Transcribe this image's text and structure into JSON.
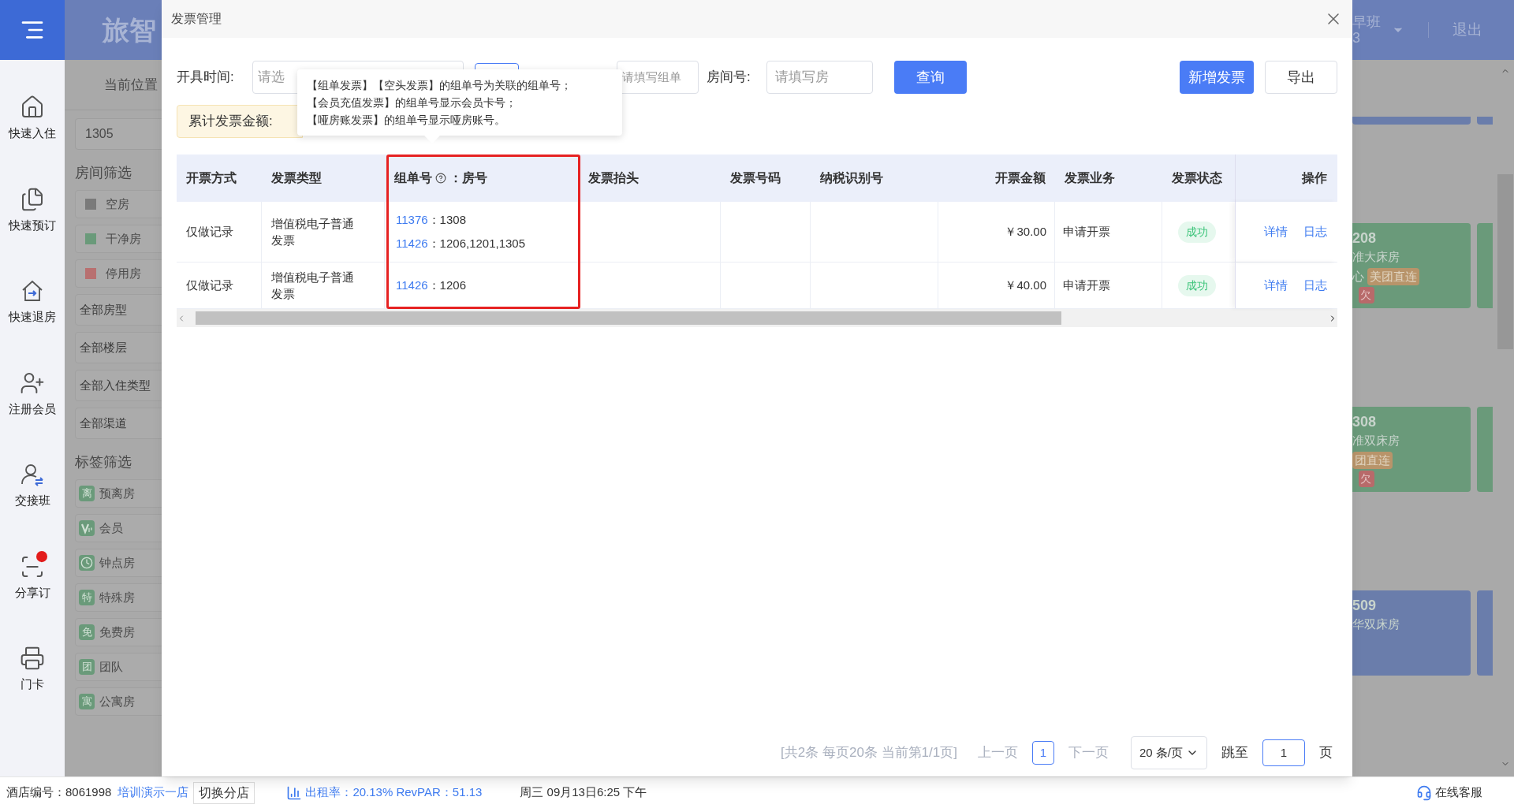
{
  "sidebar": {
    "items": [
      {
        "label": "快速入住",
        "badge": false
      },
      {
        "label": "快速预订",
        "badge": false
      },
      {
        "label": "快速退房",
        "badge": false
      },
      {
        "label": "注册会员",
        "badge": false
      },
      {
        "label": "交接班",
        "badge": false
      },
      {
        "label": "分享订",
        "badge": true
      },
      {
        "label": "门卡",
        "badge": false
      }
    ]
  },
  "background": {
    "logo": "旅智",
    "breadcrumb": "当前位置",
    "search_value": "1305",
    "room_filter_title": "房间筛选",
    "room_filters": [
      {
        "label": "空房",
        "color": "#7a7a7a"
      },
      {
        "label": "干净房",
        "color": "#6a9a7a"
      },
      {
        "label": "停用房",
        "color": "#b87070"
      }
    ],
    "selects": [
      "全部房型",
      "全部楼层",
      "全部入住类型",
      "全部渠道"
    ],
    "tag_filter_title": "标签筛选",
    "tags": [
      {
        "kind": "text",
        "mark": "离",
        "label": "预离房"
      },
      {
        "kind": "vip",
        "label": "会员"
      },
      {
        "kind": "clock",
        "label": "钟点房"
      },
      {
        "kind": "text",
        "mark": "特",
        "label": "特殊房"
      },
      {
        "kind": "text",
        "mark": "免",
        "label": "免费房"
      },
      {
        "kind": "text",
        "mark": "团",
        "label": "团队"
      },
      {
        "kind": "text",
        "mark": "寓",
        "label": "公寓房"
      }
    ],
    "shift": "早班",
    "shift_sub": "3",
    "logout": "退出",
    "rooms": [
      {
        "number": "208",
        "type": "准大床房",
        "color": "#6a9a7a",
        "prefix": "心",
        "tags": [
          "美团直连"
        ],
        "owing": "欠"
      },
      {
        "number": "308",
        "type": "准双床房",
        "color": "#6a9a7a",
        "tags": [
          "团直连"
        ],
        "owing": "欠"
      },
      {
        "number": "509",
        "type": "华双床房",
        "color": "#6a7dab"
      }
    ]
  },
  "modal": {
    "title": "发票管理",
    "filters": {
      "date_label": "开具时间:",
      "date_placeholder": "请选",
      "group_placeholder": "请填写组单",
      "room_label": "房间号:",
      "room_placeholder": "请填写房",
      "query": "查询"
    },
    "actions": [
      "新增发票",
      "导出"
    ],
    "total_label": "累计发票金额:",
    "tooltip": [
      "【组单发票】【空头发票】的组单号为关联的组单号；",
      "【会员充值发票】的组单号显示会员卡号；",
      "【哑房账发票】的组单号显示哑房账号。"
    ],
    "table": {
      "columns": [
        {
          "label": "开票方式"
        },
        {
          "label": "发票类型"
        },
        {
          "label": "组单号",
          "help": true,
          "after": "：房号",
          "highlighted": true
        },
        {
          "label": "发票抬头"
        },
        {
          "label": "发票号码"
        },
        {
          "label": "纳税识别号"
        },
        {
          "label": "开票金额"
        },
        {
          "label": "发票业务"
        },
        {
          "label": "发票状态"
        },
        {
          "label": "操作"
        }
      ],
      "rows": [
        {
          "method": "仅做记录",
          "type": "增值税电子普通发票",
          "groups": [
            {
              "id": "11376",
              "sep": "：",
              "rooms": "1308"
            },
            {
              "id": "11426",
              "sep": "：",
              "rooms": "1206,1201,1305"
            }
          ],
          "amount": "￥30.00",
          "business": "申请开票",
          "status": "成功",
          "actions": [
            "详情",
            "日志"
          ]
        },
        {
          "method": "仅做记录",
          "type": "增值税电子普通发票",
          "groups": [
            {
              "id": "11426",
              "sep": "：",
              "rooms": "1206"
            }
          ],
          "amount": "￥40.00",
          "business": "申请开票",
          "status": "成功",
          "actions": [
            "详情",
            "日志"
          ]
        }
      ]
    },
    "pagination": {
      "summary": "[共2条 每页20条 当前第1/1页]",
      "prev": "上一页",
      "pages": [
        {
          "label": "1",
          "selected": true
        }
      ],
      "next": "下一页",
      "page_size": "20 条/页",
      "jump_label": "跳至",
      "jump_value": "1",
      "unit": "页"
    }
  },
  "status_bar": {
    "hotel_label": "酒店编号：8061998",
    "hotel_name": "培训演示一店",
    "switch": "切换分店",
    "occupancy": "出租率：20.13% RevPAR：51.13",
    "datetime": "周三 09月13日6:25 下午",
    "support": "在线客服"
  }
}
